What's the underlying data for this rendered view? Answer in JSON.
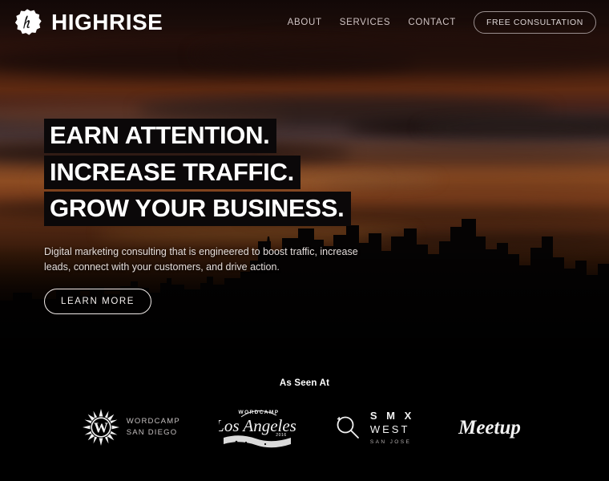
{
  "header": {
    "logo_icon": "highrise-badge-icon",
    "brand_name": "HIGHRISE",
    "nav": [
      {
        "label": "ABOUT"
      },
      {
        "label": "SERVICES"
      },
      {
        "label": "CONTACT"
      }
    ],
    "cta_label": "FREE CONSULTATION"
  },
  "hero": {
    "headline_lines": [
      "EARN ATTENTION.",
      "INCREASE TRAFFIC.",
      "GROW YOUR BUSINESS."
    ],
    "subtitle": "Digital marketing consulting that is engineered to boost traffic, increase leads, connect with your customers, and drive action.",
    "button_label": "LEARN MORE",
    "background": {
      "description": "sunset city skyline silhouette",
      "sky_colors": [
        "#120807",
        "#5e2a12",
        "#8d4c22",
        "#331808",
        "#0a0402"
      ],
      "skyline_color": "#050303"
    }
  },
  "as_seen_at": {
    "title": "As Seen At",
    "logos": [
      {
        "name": "wordcamp-san-diego-logo",
        "icon": "sunburst-w-icon",
        "line1": "WORDCAMP",
        "line2": "SAN DIEGO"
      },
      {
        "name": "wordcamp-los-angeles-logo",
        "icon": "script-banner-icon",
        "line1": "WORDCAMP",
        "line2": "Los Angeles",
        "line3": "2016"
      },
      {
        "name": "smx-west-logo",
        "icon": "magnifying-glass-icon",
        "line1": "S M X",
        "line2": "WEST",
        "line3": "SAN JOSE"
      },
      {
        "name": "meetup-logo",
        "icon": "meetup-script-icon",
        "line1": "Meetup"
      }
    ]
  },
  "colors": {
    "background": "#000000",
    "text_primary": "#ffffff",
    "text_muted": "#cfc3c3",
    "accent_sunset": "#8d4c22"
  }
}
